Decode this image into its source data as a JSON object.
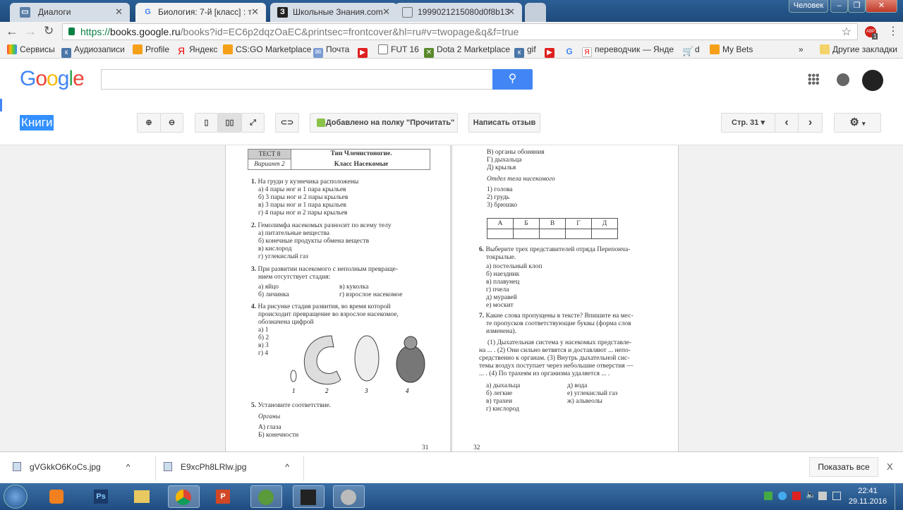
{
  "browser": {
    "tabs": [
      {
        "label": "Диалоги"
      },
      {
        "label": "Биология: 7-й [класс] : т"
      },
      {
        "label": "Школьные Знания.com"
      },
      {
        "label": "1999021215080d0f8b13"
      }
    ],
    "profile": "Человек",
    "url_scheme": "https://",
    "url_host": "books.google.ru",
    "url_path": "/books?id=EC6p2dqzOaEC&printsec=frontcover&hl=ru#v=twopage&q&f=true",
    "abp_badge": "1",
    "bookmarks": [
      "Сервисы",
      "Аудиозаписи",
      "Profile",
      "Яндекс",
      "CS:GO Marketplace",
      "Почта",
      "FUT 16",
      "Dota 2 Marketplace",
      "gif",
      "переводчик — Янде",
      "d",
      "My Bets"
    ],
    "more": "»",
    "other_bookmarks": "Другие закладки"
  },
  "google": {
    "logo": "Google",
    "search_placeholder": ""
  },
  "books": {
    "section": "Книги",
    "shelf_button": "Добавлено на полку \"Прочитать\"",
    "review_button": "Написать отзыв",
    "page_select": "Стр. 31"
  },
  "left_page": {
    "test_label": "ТЕСТ 8",
    "variant": "Вариант 2",
    "title1": "Тип Членистоногие.",
    "title2": "Класс Насекомые",
    "q1": "На груди у кузнечика расположены",
    "q1_opts": [
      "а) 4 пары ног и 1 пара крыльев",
      "б) 3 пары ног и 2 пары крыльев",
      "в) 3 пары ног и 1 пара крыльев",
      "г) 4 пары ног и 2 пары крыльев"
    ],
    "q2": "Гемолимфа насекомых разносит по всему телу",
    "q2_opts": [
      "а) питательные вещества",
      "б) конечные продукты обмена веществ",
      "в) кислород",
      "г) углекислый газ"
    ],
    "q3a": "При развитии насекомого с неполным превраще-",
    "q3b": "нием отсутствует стадия:",
    "q3_opts": [
      "а) яйцо",
      "в) куколка",
      "б) личинка",
      "г) взрослое насекомое"
    ],
    "q4a": "На рисунке стадия развития, во время которой",
    "q4b": "происходит превращение во взрослое насекомое,",
    "q4c": "обозначена цифрой",
    "q4_opts": [
      "а) 1",
      "б) 2",
      "в) 3",
      "г) 4"
    ],
    "fig_labels": [
      "1",
      "2",
      "3",
      "4"
    ],
    "q5": "Установите соответствие.",
    "organs_head": "Органы",
    "organs": [
      "А) глаза",
      "Б) конечности"
    ],
    "page_num": "31"
  },
  "right_page": {
    "organs_cont": [
      "В) органы обоняния",
      "Г) дыхальца",
      "Д) крылья"
    ],
    "body_head": "Отдел тела насекомого",
    "body": [
      "1) голова",
      "2) грудь",
      "3) брюшко"
    ],
    "table_headers": [
      "А",
      "Б",
      "В",
      "Г",
      "Д"
    ],
    "q6a": "Выберите трех представителей отряда Перепонча-",
    "q6b": "токрылые.",
    "q6_opts": [
      "а) постельный клоп",
      "б) наездник",
      "в) плавунец",
      "г) пчела",
      "д) муравей",
      "е) москит"
    ],
    "q7a": "Какие слова пропущены в тексте? Впишите на мес-",
    "q7b": "те пропусков соответствующие буквы (форма слов",
    "q7c": "изменена).",
    "text": [
      "(1) Дыхательная система у насекомых представле-",
      "на ... . (2) Они сильно ветвятся и доставляют ... непо-",
      "средственно к органам. (3) Внутрь дыхательной сис-",
      "темы воздух поступает через небольшие отверстия —",
      "... . (4) По трахеям из организма удаляется ... ."
    ],
    "q7_opts": [
      "а) дыхальца",
      "д) вода",
      "б) легкие",
      "е) углекислый газ",
      "в) трахеи",
      "ж) альвеолы",
      "г) кислород"
    ],
    "page_num": "32"
  },
  "downloads": {
    "items": [
      "gVGkkO6KoCs.jpg",
      "E9xcPh8LRlw.jpg"
    ],
    "show_all": "Показать все",
    "close": "X"
  },
  "taskbar": {
    "time": "22:41",
    "date": "29.11.2016"
  }
}
